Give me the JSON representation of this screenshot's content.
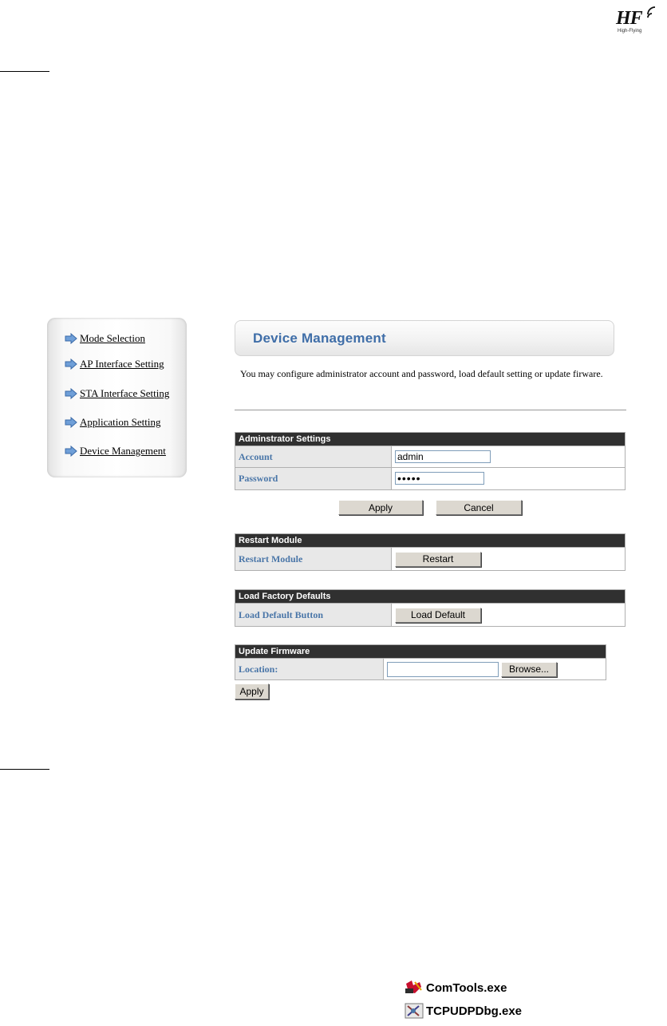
{
  "logo": {
    "mark": "HF",
    "tagline": "High-Flying"
  },
  "sidebar": {
    "items": [
      {
        "label": "Mode Selection"
      },
      {
        "label": "AP Interface Setting"
      },
      {
        "label": "STA Interface Setting"
      },
      {
        "label": "Application Setting"
      },
      {
        "label": "Device Management"
      }
    ]
  },
  "main": {
    "title": "Device Management",
    "description": "You may configure administrator account and password, load default setting or update firware."
  },
  "admin": {
    "header": "Adminstrator Settings",
    "account_label": "Account",
    "account_value": "admin",
    "password_label": "Password",
    "password_value": "•••••",
    "apply_label": "Apply",
    "cancel_label": "Cancel"
  },
  "restart": {
    "header": "Restart Module",
    "row_label": "Restart Module",
    "button_label": "Restart"
  },
  "factory": {
    "header": "Load Factory Defaults",
    "row_label": "Load Default Button",
    "button_label": "Load Default"
  },
  "firmware": {
    "header": "Update Firmware",
    "location_label": "Location:",
    "location_value": "",
    "browse_label": "Browse...",
    "apply_label": "Apply"
  },
  "files": [
    {
      "name": "ComTools.exe",
      "icon": "comtools-icon"
    },
    {
      "name": "TCPUDPDbg.exe",
      "icon": "tcpudpdbg-icon"
    }
  ],
  "colors": {
    "accent": "#3f6ea8",
    "table_header": "#303030",
    "label_bg": "#e8e8e8"
  }
}
